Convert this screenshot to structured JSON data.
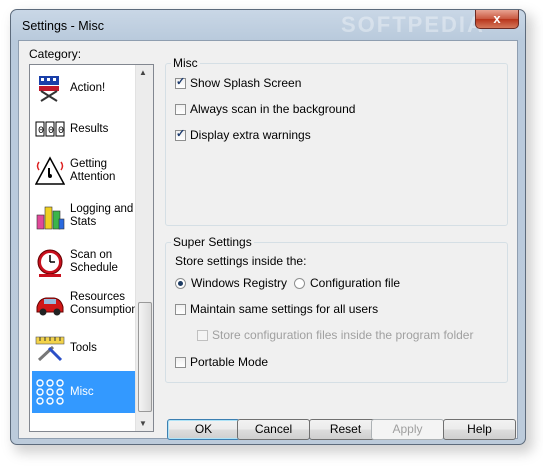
{
  "window": {
    "title": "Settings - Misc",
    "watermark": "SOFTPEDIA",
    "close_glyph": "x"
  },
  "category": {
    "label": "Category:",
    "items": [
      {
        "label": "Action!",
        "icon": "director-chair-icon",
        "selected": false
      },
      {
        "label": "Results",
        "icon": "counter-icon",
        "selected": false
      },
      {
        "label": "Getting Attention",
        "icon": "warning-sign-icon",
        "selected": false
      },
      {
        "label": "Logging and Stats",
        "icon": "bar-chart-icon",
        "selected": false
      },
      {
        "label": "Scan on Schedule",
        "icon": "alarm-clock-icon",
        "selected": false
      },
      {
        "label": "Resources Consumption",
        "icon": "sports-car-icon",
        "selected": false
      },
      {
        "label": "Tools",
        "icon": "tools-icon",
        "selected": false
      },
      {
        "label": "Misc",
        "icon": "dots-grid-icon",
        "selected": true
      }
    ]
  },
  "misc": {
    "title": "Misc",
    "show_splash": {
      "label": "Show Splash Screen",
      "checked": true
    },
    "always_scan": {
      "label": "Always scan in the background",
      "checked": false
    },
    "extra_warnings": {
      "label": "Display extra warnings",
      "checked": true
    }
  },
  "super": {
    "title": "Super Settings",
    "store_label": "Store settings inside the:",
    "registry": {
      "label": "Windows Registry",
      "selected": true
    },
    "config_file": {
      "label": "Configuration file",
      "selected": false
    },
    "same_settings": {
      "label": "Maintain same settings for all users",
      "checked": false
    },
    "store_config": {
      "label": "Store configuration files inside the program folder",
      "checked": false,
      "disabled": true
    },
    "portable": {
      "label": "Portable Mode",
      "checked": false
    }
  },
  "buttons": {
    "ok": "OK",
    "cancel": "Cancel",
    "reset": "Reset",
    "apply": "Apply",
    "help": "Help"
  }
}
